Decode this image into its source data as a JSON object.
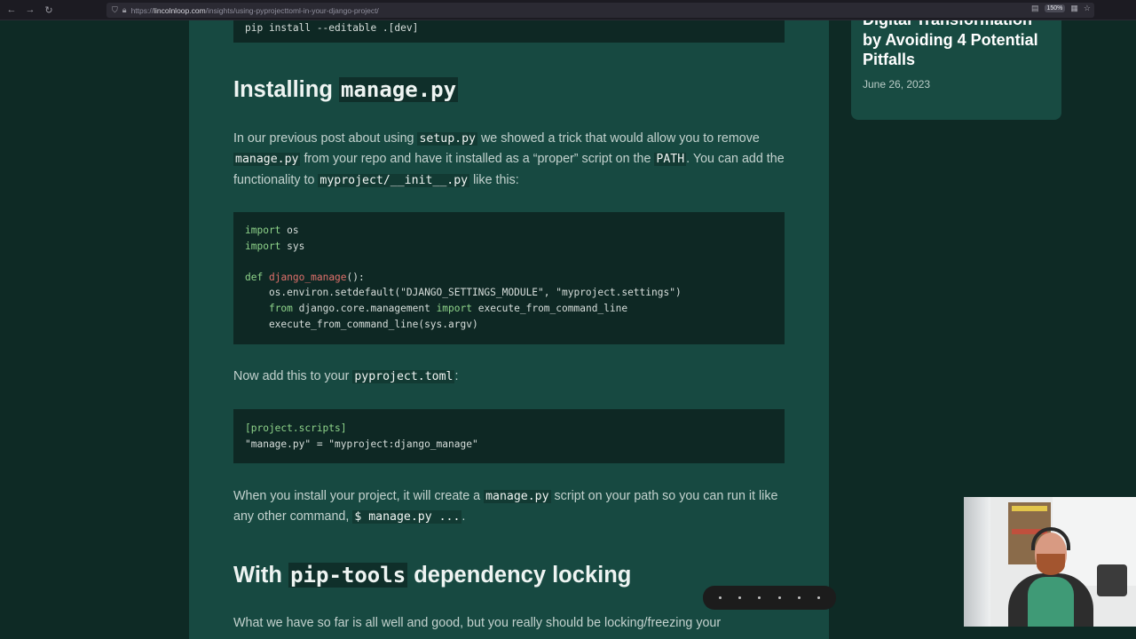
{
  "browser": {
    "url_host": "lincolnloop.com",
    "url_prefix": "https://",
    "url_path": "/insights/using-pyprojecttoml-in-your-django-project/",
    "zoom": "150%"
  },
  "article": {
    "top_code": "pip install --editable .[dev]",
    "heading1_text": "Installing ",
    "heading1_code": "manage.py",
    "p1": {
      "t1": "In our previous post about using ",
      "c1": "setup.py",
      "t2": " we showed a trick that would allow you to remove ",
      "c2": "manage.py",
      "t3": " from your repo and have it installed as a “proper” script on the ",
      "c3": "PATH",
      "t4": ". You can add the functionality to ",
      "c4": "myproject/__init__.py",
      "t5": " like this:"
    },
    "code1": {
      "l1_kw": "import",
      "l1_rest": " os",
      "l2_kw": "import",
      "l2_rest": " sys",
      "l4_kw": "def",
      "l4_fn": "django_manage",
      "l4_rest": "():",
      "l5": "    os.environ.setdefault(\"DJANGO_SETTINGS_MODULE\", \"myproject.settings\")",
      "l6_indent": "    ",
      "l6_kw1": "from",
      "l6_mid": " django.core.management ",
      "l6_kw2": "import",
      "l6_rest": " execute_from_command_line",
      "l7": "    execute_from_command_line(sys.argv)"
    },
    "p2": {
      "t1": "Now add this to your ",
      "c1": "pyproject.toml",
      "t2": ":"
    },
    "code2": {
      "l1": "[project.scripts]",
      "l2": "\"manage.py\" = \"myproject:django_manage\""
    },
    "p3": {
      "t1": "When you install your project, it will create a ",
      "c1": "manage.py",
      "t2": " script on your path so you can run it like any other command, ",
      "c2": "$ manage.py ...",
      "t3": "."
    },
    "heading2": {
      "t1": "With ",
      "code": "pip-tools",
      "t2": " dependency locking"
    },
    "p4": "What we have so far is all well and good, but you really should be locking/freezing your"
  },
  "sidebar": {
    "title": "Digital Transformation by Avoiding 4 Potential Pitfalls",
    "date": "June 26, 2023"
  },
  "icons": {
    "back": "back-arrow-icon",
    "forward": "forward-arrow-icon",
    "reload": "reload-icon",
    "shield": "shield-icon",
    "lock": "lock-icon",
    "reader": "reader-view-icon",
    "extensions": "grid-icon",
    "bookmark": "star-icon"
  }
}
